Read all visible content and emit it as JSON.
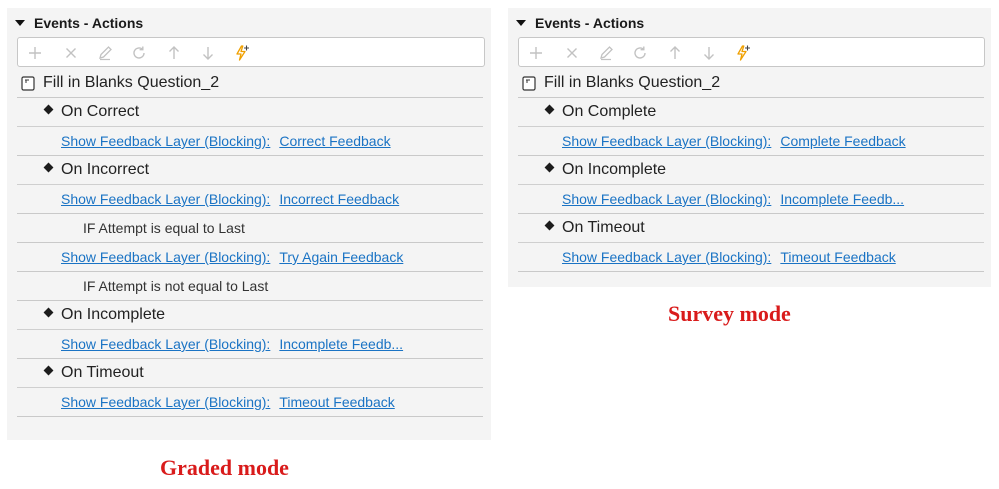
{
  "left_panel": {
    "header": "Events - Actions",
    "question": "Fill in Blanks Question_2",
    "rows": [
      {
        "type": "event",
        "label": "On Correct"
      },
      {
        "type": "action",
        "action": "Show Feedback Layer (Blocking):",
        "target": "Correct Feedback"
      },
      {
        "type": "event",
        "label": "On Incorrect"
      },
      {
        "type": "action",
        "action": "Show Feedback Layer (Blocking):",
        "target": "Incorrect Feedback"
      },
      {
        "type": "condition",
        "label": "IF Attempt is equal to Last"
      },
      {
        "type": "action",
        "action": "Show Feedback Layer (Blocking):",
        "target": "Try Again Feedback"
      },
      {
        "type": "condition",
        "label": "IF Attempt is not equal to Last"
      },
      {
        "type": "event",
        "label": "On Incomplete"
      },
      {
        "type": "action",
        "action": "Show Feedback Layer (Blocking):",
        "target": "Incomplete Feedb..."
      },
      {
        "type": "event",
        "label": "On Timeout"
      },
      {
        "type": "action",
        "action": "Show Feedback Layer (Blocking):",
        "target": "Timeout Feedback"
      }
    ],
    "caption": "Graded mode"
  },
  "right_panel": {
    "header": "Events - Actions",
    "question": "Fill in Blanks Question_2",
    "rows": [
      {
        "type": "event",
        "label": "On Complete"
      },
      {
        "type": "action",
        "action": "Show Feedback Layer (Blocking):",
        "target": "Complete Feedback"
      },
      {
        "type": "event",
        "label": "On Incomplete"
      },
      {
        "type": "action",
        "action": "Show Feedback Layer (Blocking):",
        "target": "Incomplete Feedb..."
      },
      {
        "type": "event",
        "label": "On Timeout"
      },
      {
        "type": "action",
        "action": "Show Feedback Layer (Blocking):",
        "target": "Timeout Feedback"
      }
    ],
    "caption": "Survey mode"
  },
  "toolbar_icons": [
    "add-icon",
    "delete-icon",
    "edit-icon",
    "refresh-icon",
    "move-up-icon",
    "move-down-icon",
    "add-trigger-icon"
  ],
  "colors": {
    "panel_bg": "#f4f4f4",
    "link": "#1a73c4",
    "caption": "#d91b1b",
    "toolbar_icon_disabled": "#c2c2c2",
    "trigger_icon": "#f0a000"
  }
}
